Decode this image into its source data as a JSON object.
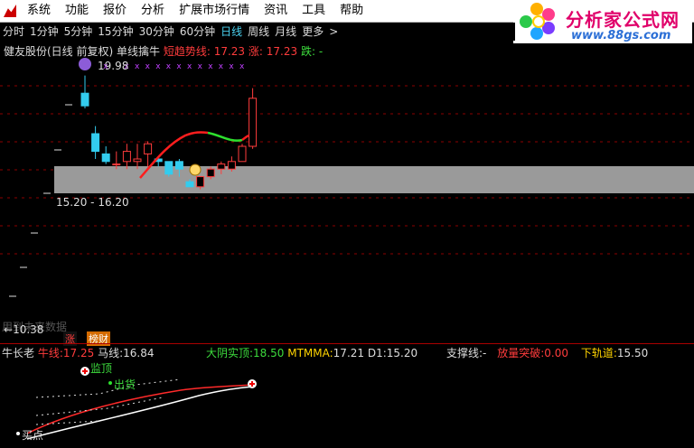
{
  "menubar": {
    "items": [
      "系统",
      "功能",
      "报价",
      "分析",
      "扩展市场行情",
      "资讯",
      "工具",
      "帮助"
    ]
  },
  "logo": {
    "name": "分析家公式网",
    "url": "www.88gs.com"
  },
  "period_tabs": [
    "分时",
    "1分钟",
    "5分钟",
    "15分钟",
    "30分钟",
    "60分钟",
    "日线",
    "周线",
    "月线",
    "更多"
  ],
  "period_active": "日线",
  "period_more_arrow": ">",
  "chart_info": {
    "stock": "健友股份(日线 前复权) 单线擒牛",
    "short_trend_label": "短趋势线:",
    "short_trend_value": "17.23",
    "rise_label": "涨:",
    "rise_value": "17.23",
    "fall_label": "跌:",
    "fall_value": "-"
  },
  "main_chart": {
    "high_marker": "19.98",
    "range_label": "15.20 - 16.20",
    "low_marker": "10.38",
    "watermark": "用到未来数据",
    "badge_zhang": "涨",
    "badge_bangcai": "榜财",
    "colors": {
      "up": "#ff3c3c",
      "down": "#3ce",
      "band": "#9a9a9a",
      "trend_red": "#ff1e1e",
      "trend_green": "#2ee02e"
    }
  },
  "chart_data": {
    "type": "candlestick",
    "y_range": [
      10.0,
      21.0
    ],
    "candles": [
      {
        "o": 19.6,
        "h": 20.3,
        "l": 19.0,
        "c": 19.1
      },
      {
        "o": 18.0,
        "h": 18.3,
        "l": 17.0,
        "c": 17.3
      },
      {
        "o": 17.2,
        "h": 17.5,
        "l": 16.8,
        "c": 16.9
      },
      {
        "o": 16.8,
        "h": 17.3,
        "l": 16.6,
        "c": 16.8
      },
      {
        "o": 16.9,
        "h": 17.6,
        "l": 16.6,
        "c": 17.3
      },
      {
        "o": 16.9,
        "h": 17.6,
        "l": 16.6,
        "c": 17.0
      },
      {
        "o": 17.2,
        "h": 17.7,
        "l": 16.7,
        "c": 17.6
      },
      {
        "o": 17.0,
        "h": 17.1,
        "l": 16.7,
        "c": 16.9
      },
      {
        "o": 16.9,
        "h": 16.9,
        "l": 16.3,
        "c": 16.4
      },
      {
        "o": 16.9,
        "h": 17.0,
        "l": 16.3,
        "c": 16.6
      },
      {
        "o": 16.1,
        "h": 16.2,
        "l": 15.9,
        "c": 15.9
      },
      {
        "o": 15.9,
        "h": 16.3,
        "l": 15.8,
        "c": 16.3
      },
      {
        "o": 16.3,
        "h": 16.7,
        "l": 16.2,
        "c": 16.6
      },
      {
        "o": 16.6,
        "h": 16.9,
        "l": 16.4,
        "c": 16.8
      },
      {
        "o": 16.6,
        "h": 17.1,
        "l": 16.5,
        "c": 16.9
      },
      {
        "o": 16.9,
        "h": 17.6,
        "l": 16.9,
        "c": 17.5
      },
      {
        "o": 17.5,
        "h": 19.8,
        "l": 17.4,
        "c": 19.4
      }
    ],
    "band": [
      15.2,
      16.2
    ]
  },
  "indicator": {
    "name": "牛长老",
    "bull_label": "牛线:",
    "bull_value": "17.25",
    "horse_label": "马线:",
    "horse_value": "16.84",
    "yin_label": "大阴实顶:",
    "yin_value": "18.50",
    "mtmma_label": "MTMMA:",
    "mtmma_value": "17.21",
    "d1_label": "D1:",
    "d1_value": "15.20",
    "support_label": "支撑线:",
    "support_value": "-",
    "breakout_label": "放量突破:",
    "breakout_value": "0.00",
    "lower_label": "下轨道:",
    "lower_value": "15.50",
    "signal_jianchi": "监顶",
    "signal_chuhuo": "出货",
    "signal_maidian": "买点"
  }
}
